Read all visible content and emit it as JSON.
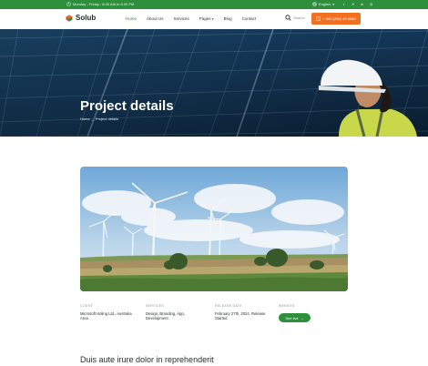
{
  "topbar": {
    "hours": "Monday - Friday : 8.00 AM to 8.00 PM",
    "language": "English",
    "social_icons": [
      "facebook-icon",
      "twitter-icon",
      "linkedin-icon",
      "instagram-icon"
    ]
  },
  "header": {
    "logo": "Solub",
    "nav": [
      "Home",
      "About Us",
      "Services",
      "Pages",
      "Blog",
      "Contact"
    ],
    "search_placeholder": "Search",
    "cta": "+ 880 (253) 45 6890"
  },
  "hero": {
    "title": "Project details",
    "breadcrumb": [
      "Home",
      "_",
      "Project details"
    ]
  },
  "meta": {
    "client_label": "CLIENT",
    "client_value": "Microsoft Holing Ltd., Australia Area",
    "services_label": "SERVICES",
    "services_value": "Design, Branding, App, Development",
    "date_label": "RELEASE DATE",
    "date_value": "February 27th, 2024. Release Started",
    "website_label": "WEBSITE",
    "website_button": "See live"
  },
  "section": {
    "title": "Duis aute irure dolor in reprehenderit"
  },
  "colors": {
    "brand_green": "#2d8f3c",
    "accent_orange": "#f36f21",
    "hero_blue": "#173a5a"
  }
}
